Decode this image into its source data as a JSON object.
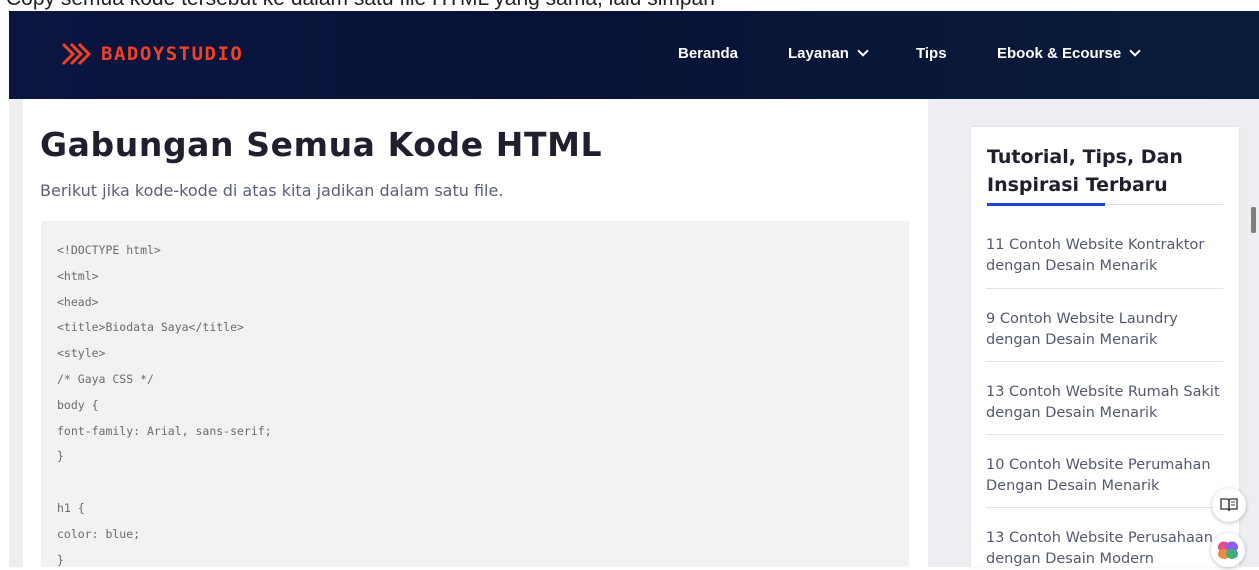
{
  "top_caption": "Copy semua kode tersebut ke dalam satu file HTML yang sama, lalu simpan",
  "brand": {
    "name": "BADOYSTUDIO",
    "accent_color": "#ef4123"
  },
  "nav": {
    "home": "Beranda",
    "services": "Layanan",
    "tips": "Tips",
    "ebook": "Ebook & Ecourse"
  },
  "article": {
    "heading": "Gabungan Semua Kode HTML",
    "intro": "Berikut jika kode-kode di atas kita jadikan dalam satu file.",
    "code_lines": [
      "<!DOCTYPE html>",
      "<html>",
      "<head>",
      "<title>Biodata Saya</title>",
      "<style>",
      "/* Gaya CSS */",
      "body {",
      "font-family: Arial, sans-serif;",
      "}",
      "",
      "h1 {",
      "color: blue;",
      "}"
    ]
  },
  "sidebar": {
    "title": "Tutorial, Tips, Dan Inspirasi Terbaru",
    "accent_color": "#1f45d6",
    "posts": [
      {
        "title": "11 Contoh Website Kontraktor dengan Desain Menarik"
      },
      {
        "title": "9 Contoh Website Laundry dengan Desain Menarik"
      },
      {
        "title": "13 Contoh Website Rumah Sakit dengan Desain Menarik"
      },
      {
        "title": "10 Contoh Website Perumahan Dengan Desain Menarik"
      },
      {
        "title": "13 Contoh Website Perusahaan dengan Desain Modern"
      }
    ]
  },
  "icons": {
    "logo": "chevron-logo-icon",
    "dropdown": "chevron-down-icon",
    "reader": "book-icon",
    "assistant": "brain-icon"
  }
}
